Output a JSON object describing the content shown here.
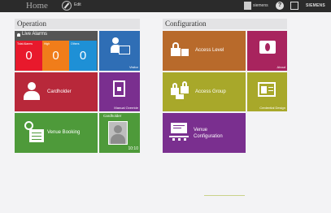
{
  "topbar": {
    "title": "Home",
    "edit_label": "Edit",
    "user_name": "siemens",
    "help_glyph": "?",
    "logo": "SIEMENS",
    "icons": [
      "edit-icon",
      "user-icon",
      "help-icon",
      "fullscreen-icon"
    ]
  },
  "operation": {
    "header": "Operation",
    "live_alarms": {
      "title": "Live Alarms",
      "boxes": [
        {
          "label": "Total Alarms",
          "value": "0",
          "color": "#e8192c"
        },
        {
          "label": "High",
          "value": "0",
          "color": "#f07d1a"
        },
        {
          "label": "Others",
          "value": "0",
          "color": "#1e90d6"
        }
      ]
    },
    "visitor": {
      "label": "Visitor",
      "color": "#2f6eb5"
    },
    "cardholder": {
      "label": "Cardholder",
      "color": "#b8283a"
    },
    "manual_override": {
      "label": "Manual Override",
      "color": "#7a2f8f"
    },
    "venue_booking": {
      "label": "Venue Booking",
      "color": "#4e9a3a"
    },
    "cardholder_photo": {
      "label": "Cardholder",
      "time": "10:10",
      "color": "#4e9a3a"
    }
  },
  "configuration": {
    "header": "Configuration",
    "access_level": {
      "label": "Access Level",
      "color": "#b86a2b"
    },
    "about": {
      "label": "About",
      "color": "#a8245e"
    },
    "access_group": {
      "label": "Access Group",
      "color": "#a8a82a"
    },
    "credential_design": {
      "label": "Credential Design",
      "color": "#a8a82a"
    },
    "venue_configuration": {
      "label": "Venue Configuration",
      "color": "#7a2f8f"
    }
  }
}
